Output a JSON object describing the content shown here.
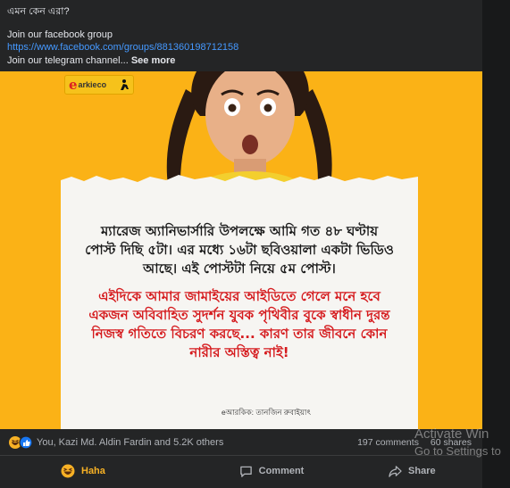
{
  "post": {
    "title_line": "এমন কেন এরা?",
    "join_group": "Join our facebook group",
    "group_link": "https://www.facebook.com/groups/881360198712158",
    "join_telegram": "Join our telegram channel...",
    "see_more": "See more"
  },
  "image": {
    "logo_e": "e",
    "logo_text": "arkieco",
    "text_black": "ম্যারেজ অ্যানিভার্সারি উপলক্ষে আমি গত ৪৮ ঘণ্টায় পোস্ট দিছি ৫টা। এর মধ্যে ১৬টা ছবিওয়ালা একটা ভিডিও আছে। এই পোস্টটা নিয়ে ৫ম পোস্ট।",
    "text_red": "এইদিকে আমার জামাইয়ের আইডিতে গেলে মনে হবে একজন অবিবাহিত সুদর্শন যুবক পৃথিবীর বুকে স্বাধীন দুরন্ত নিজস্ব গতিতে বিচরণ করছে... কারণ তার জীবনে কোন নারীর অস্তিত্ব নাই!",
    "credit": "eআরকিক: তানজিন রুবাইয়াৎ"
  },
  "reactions": {
    "names": "You, Kazi Md. Aldin Fardin and 5.2K others",
    "comments": "197 comments",
    "shares": "60 shares"
  },
  "actions": {
    "haha_label": "Haha",
    "comment_label": "Comment",
    "share_label": "Share"
  },
  "watermark": {
    "line1": "Activate Win",
    "line2": "Go to Settings to"
  },
  "colors": {
    "haha": "#f7b125",
    "link": "#4599ff",
    "image_bg": "#fbb216",
    "red_text": "#d51a1d"
  }
}
